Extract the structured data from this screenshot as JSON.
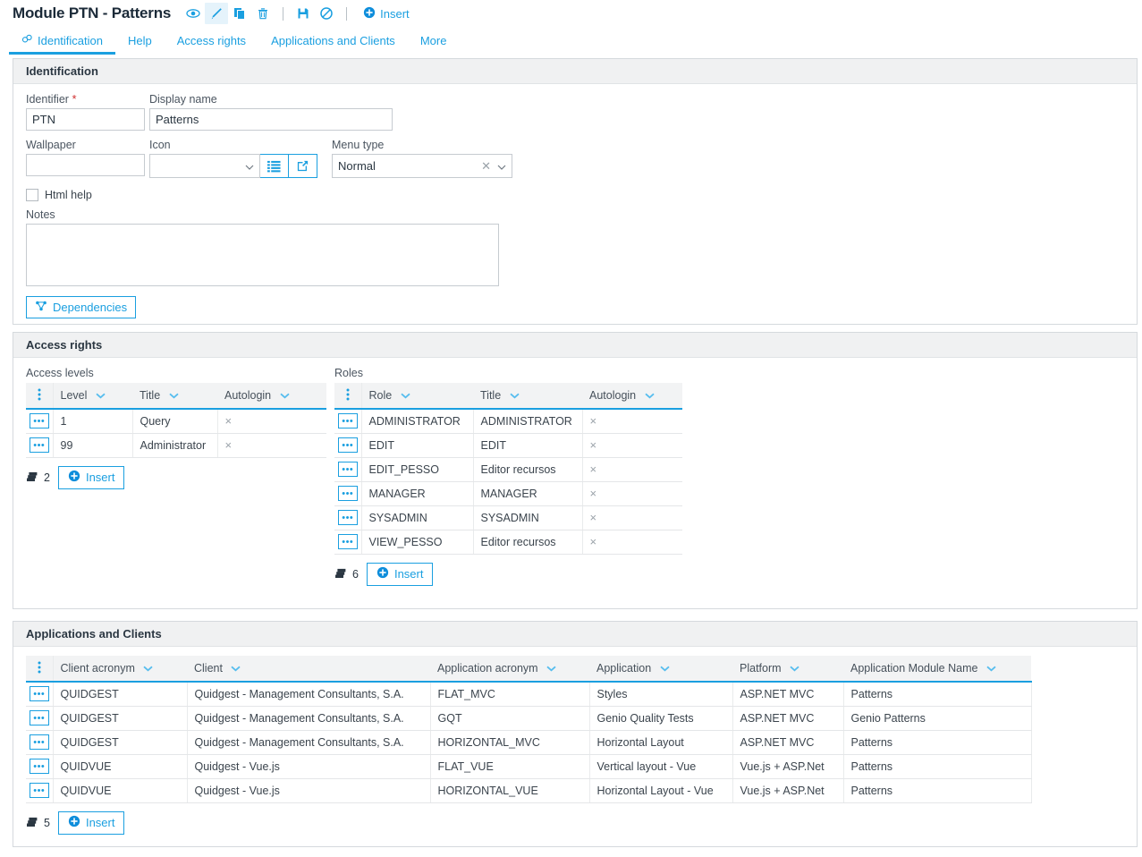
{
  "titlebar": {
    "title": "Module PTN - Patterns",
    "actions": [
      {
        "name": "view-icon",
        "label": "View",
        "active": false
      },
      {
        "name": "edit-icon",
        "label": "Edit",
        "active": true
      },
      {
        "name": "duplicate-icon",
        "label": "Duplicate",
        "active": false
      },
      {
        "name": "delete-icon",
        "label": "Delete",
        "active": false
      },
      {
        "name": "save-icon",
        "label": "Save",
        "active": false
      },
      {
        "name": "cancel-icon",
        "label": "Cancel",
        "active": false
      }
    ],
    "insert_label": "Insert"
  },
  "tabs": [
    {
      "label": "Identification",
      "active": true,
      "icon": "link-icon"
    },
    {
      "label": "Help",
      "active": false
    },
    {
      "label": "Access rights",
      "active": false
    },
    {
      "label": "Applications and Clients",
      "active": false
    },
    {
      "label": "More",
      "active": false
    }
  ],
  "identification": {
    "section_title": "Identification",
    "identifier_label": "Identifier",
    "identifier_required": "*",
    "identifier_value": "PTN",
    "display_name_label": "Display name",
    "display_name_value": "Patterns",
    "wallpaper_label": "Wallpaper",
    "wallpaper_value": "",
    "icon_label": "Icon",
    "icon_value": "",
    "menu_type_label": "Menu type",
    "menu_type_value": "Normal",
    "html_help_label": "Html help",
    "html_help_checked": false,
    "notes_label": "Notes",
    "notes_value": "",
    "dependencies_label": "Dependencies"
  },
  "access_rights": {
    "section_title": "Access rights",
    "levels": {
      "caption": "Access levels",
      "columns": [
        "Level",
        "Title",
        "Autologin"
      ],
      "rows": [
        {
          "level": "1",
          "title": "Query",
          "autologin": "×"
        },
        {
          "level": "99",
          "title": "Administrator",
          "autologin": "×"
        }
      ],
      "count": "2",
      "insert_label": "Insert"
    },
    "roles": {
      "caption": "Roles",
      "columns": [
        "Role",
        "Title",
        "Autologin"
      ],
      "rows": [
        {
          "role": "ADMINISTRATOR",
          "title": "ADMINISTRATOR",
          "autologin": "×"
        },
        {
          "role": "EDIT",
          "title": "EDIT",
          "autologin": "×"
        },
        {
          "role": "EDIT_PESSO",
          "title": "Editor recursos",
          "autologin": "×"
        },
        {
          "role": "MANAGER",
          "title": "MANAGER",
          "autologin": "×"
        },
        {
          "role": "SYSADMIN",
          "title": "SYSADMIN",
          "autologin": "×"
        },
        {
          "role": "VIEW_PESSO",
          "title": "Editor recursos",
          "autologin": "×"
        }
      ],
      "count": "6",
      "insert_label": "Insert"
    }
  },
  "applications": {
    "section_title": "Applications and Clients",
    "columns": [
      "Client acronym",
      "Client",
      "Application acronym",
      "Application",
      "Platform",
      "Application Module Name"
    ],
    "rows": [
      {
        "client_acronym": "QUIDGEST",
        "client": "Quidgest - Management Consultants, S.A.",
        "application_acronym": "FLAT_MVC",
        "application": "Styles",
        "platform": "ASP.NET MVC",
        "module_name": "Patterns"
      },
      {
        "client_acronym": "QUIDGEST",
        "client": "Quidgest - Management Consultants, S.A.",
        "application_acronym": "GQT",
        "application": "Genio Quality Tests",
        "platform": "ASP.NET MVC",
        "module_name": "Genio Patterns"
      },
      {
        "client_acronym": "QUIDGEST",
        "client": "Quidgest - Management Consultants, S.A.",
        "application_acronym": "HORIZONTAL_MVC",
        "application": "Horizontal Layout",
        "platform": "ASP.NET MVC",
        "module_name": "Patterns"
      },
      {
        "client_acronym": "QUIDVUE",
        "client": "Quidgest - Vue.js",
        "application_acronym": "FLAT_VUE",
        "application": "Vertical layout - Vue",
        "platform": "Vue.js + ASP.Net",
        "module_name": "Patterns"
      },
      {
        "client_acronym": "QUIDVUE",
        "client": "Quidgest - Vue.js",
        "application_acronym": "HORIZONTAL_VUE",
        "application": "Horizontal Layout - Vue",
        "platform": "Vue.js + ASP.Net",
        "module_name": "Patterns"
      }
    ],
    "count": "5",
    "insert_label": "Insert"
  },
  "colors": {
    "accent": "#1a9fe0",
    "header_bg": "#f0f1f2",
    "grid_header_bg": "#f2f3f4",
    "border": "#d5d9dd",
    "text": "#3b444d",
    "required": "#d03030"
  }
}
